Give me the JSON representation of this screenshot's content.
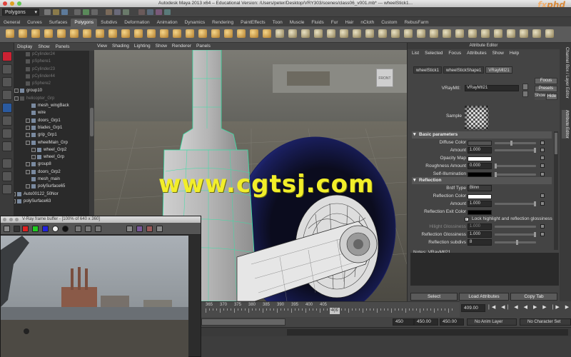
{
  "window": {
    "title": "Autodesk Maya 2013 x64 – Educational Version: /Users/peter/Desktop/VRY303/scenes/class06_v001.mb*  ---   wheelStick1...",
    "brand_prefix": "fx",
    "brand_suffix": "phd"
  },
  "status_line": {
    "menu_set": "Polygons"
  },
  "shelf_tabs": [
    "General",
    "Curves",
    "Surfaces",
    "Polygons",
    "Subdivs",
    "Deformation",
    "Animation",
    "Dynamics",
    "Rendering",
    "PaintEffects",
    "Toon",
    "Muscle",
    "Fluids",
    "Fur",
    "Hair",
    "nCloth",
    "Custom",
    "RebusFarm"
  ],
  "active_shelf_tab": "Polygons",
  "outliner": {
    "menu": [
      "Display",
      "Show",
      "Panels"
    ],
    "items": [
      {
        "label": "pCylinder24",
        "dim": true
      },
      {
        "label": "pSphere1",
        "dim": true
      },
      {
        "label": "pCylinder23",
        "dim": true
      },
      {
        "label": "pCylinder44",
        "dim": true
      },
      {
        "label": "pSphere2",
        "dim": true
      },
      {
        "label": "group10",
        "dim": false
      },
      {
        "label": "helicopter_Grp",
        "dim": true
      },
      {
        "label": "mesh_wingBack",
        "dim": false
      },
      {
        "label": "wire",
        "dim": false
      },
      {
        "label": "doors_Grp1",
        "dim": false
      },
      {
        "label": "blades_Grp1",
        "dim": false
      },
      {
        "label": "grip_Grp1",
        "dim": false
      },
      {
        "label": "wheelMain_Grp",
        "dim": false
      },
      {
        "label": "wheel_Grp2",
        "dim": false
      },
      {
        "label": "wheel_Grp",
        "dim": false
      },
      {
        "label": "group8",
        "dim": false
      },
      {
        "label": "doors_Grp2",
        "dim": false
      },
      {
        "label": "mesh_main",
        "dim": false
      },
      {
        "label": "polySurface65",
        "dim": false
      },
      {
        "label": "Auto00122_50Nor",
        "dim": false
      },
      {
        "label": "polySurface63",
        "dim": false
      }
    ]
  },
  "viewport": {
    "menu": [
      "View",
      "Shading",
      "Lighting",
      "Show",
      "Renderer",
      "Panels"
    ],
    "watermark": "www.cgtsj.com",
    "viewcube_label": "FRONT"
  },
  "vfb": {
    "title": "V-Ray frame buffer - [100% of 640 x 360]"
  },
  "timeline": {
    "tick_labels": [
      "365",
      "370",
      "375",
      "380",
      "385",
      "390",
      "395",
      "400",
      "405"
    ],
    "current_frame": "409",
    "current_time": "409.00",
    "transport": "|◀ ◀| ◀ ◀ ▶ ▶ |▶ ▶|"
  },
  "range": {
    "end_frame": "450",
    "anim_end": "450.00",
    "range_end": "450.00",
    "anim_layer": "No Anim Layer",
    "character_set": "No Character Set"
  },
  "attribute_editor": {
    "title": "Attribute Editor",
    "menu": [
      "List",
      "Selected",
      "Focus",
      "Attributes",
      "Show",
      "Help"
    ],
    "tabs": [
      "wheelStick1",
      "wheelStickShape1",
      "VRayMtl21"
    ],
    "active_tab": "VRayMtl21",
    "vraymtl_label": "VRayMtl:",
    "vraymtl_value": "VRayMtl21",
    "focus_button": "Focus",
    "presets_button": "Presets",
    "show_button": "Show",
    "hide_button": "Hide",
    "sample_label": "Sample",
    "basic_section": "Basic parameters",
    "basic": {
      "diffuse_color": "Diffuse Color",
      "amount": "Amount",
      "amount_value": "1.000",
      "opacity_map": "Opacity Map",
      "roughness_amount": "Roughness Amount",
      "roughness_value": "0.000",
      "self_illumination": "Self-Illumination"
    },
    "reflection_section": "Reflection",
    "reflection": {
      "brdf_type": "Brdf Type",
      "brdf_value": "Blinn",
      "reflection_color": "Reflection Color",
      "amount": "Amount",
      "amount_value": "1.000",
      "exit_color": "Reflection Exit Color",
      "lock_label": "Lock highlight and reflection glossiness",
      "hilight_glossiness": "Hilight Glossiness",
      "hilight_value": "1.000",
      "reflection_glossiness": "Reflection Glossiness",
      "reflection_glossiness_value": "1.000",
      "reflection_subdivs": "Reflection subdivs",
      "reflection_subdivs_value": "8"
    },
    "notes_label": "Notes:  VRayMtl21",
    "select_button": "Select",
    "load_attributes_button": "Load Attributes",
    "copy_tab_button": "Copy Tab"
  },
  "side_tabs": [
    "Channel Box / Layer Editor",
    "Attribute Editor"
  ],
  "colors": {
    "watermark": "#f2ee2a",
    "brand": "#d98a3a",
    "wireframe": "#38e0a6",
    "tire": "#1a1f5e"
  }
}
